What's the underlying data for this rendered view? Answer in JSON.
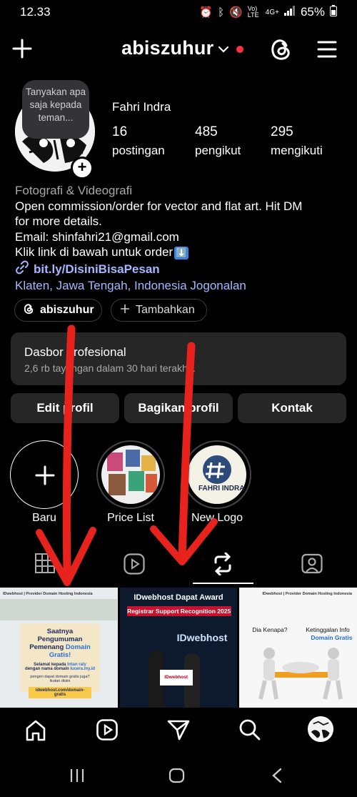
{
  "status": {
    "time": "12.33",
    "battery": "65%",
    "network": "4G+",
    "volte": "Vo) LTE"
  },
  "header": {
    "username": "abiszuhur"
  },
  "note": {
    "text": "Tanyakan apa saja kepada teman..."
  },
  "profile": {
    "name": "Fahri Indra",
    "stats": [
      {
        "value": "16",
        "label": "postingan"
      },
      {
        "value": "485",
        "label": "pengikut"
      },
      {
        "value": "295",
        "label": "mengikuti"
      }
    ]
  },
  "bio": {
    "category": "Fotografi & Videografi",
    "line1": "Open commission/order for vector and flat art. Hit DM",
    "line2": "for more details.",
    "email": "Email: shinfahri21@gmail.com",
    "cta": "Klik link di bawah untuk order",
    "cta_emoji": "⬇️",
    "link": "bit.ly/DisiniBisaPesan",
    "location": "Klaten, Jawa Tengah, Indonesia Jogonalan"
  },
  "pills": {
    "threads": "abiszuhur",
    "add": "Tambahkan"
  },
  "dashboard": {
    "title": "Dasbor profesional",
    "subtitle": "2,6 rb tayangan dalam 30 hari terakhir."
  },
  "buttons": {
    "edit": "Edit profil",
    "share": "Bagikan profil",
    "contact": "Kontak"
  },
  "highlights": [
    {
      "label": "Baru"
    },
    {
      "label": "Price List"
    },
    {
      "label": "New Logo",
      "logo_text": "FAHRI INDRA"
    }
  ],
  "posts": [
    {
      "brand": "IDwebhost | Provider Domain Hosting Indonesia",
      "title1": "Saatnya Pengumuman",
      "title2": "Pemenang",
      "title2_accent": "Domain Gratis!",
      "line1": "Selamat kepada",
      "line1_accent": "lntan raly",
      "line2": "dengan nama domain",
      "line2_accent": "lucera.my.id",
      "line3": "pengen dapat domain gratis juga?",
      "line4": "ikutan disini",
      "url": "idwebhost.com/domain-gratis"
    },
    {
      "title": "IDwebhost Dapat Award",
      "banner": "Registrar Support Recognition 2025",
      "backdrop": "IDwebhost",
      "board": "IDwebhost"
    },
    {
      "brand": "IDwebhost | Provider Domain Hosting Indonesia",
      "q": "Dia Kenapa?",
      "t1": "Ketinggalan Info",
      "t2": "Domain Gratis"
    }
  ],
  "colors": {
    "accent_link": "#a4b9ff",
    "surface": "#262626",
    "arrow": "#e8231e",
    "notif": "#ff3040"
  },
  "icons": [
    "plus-icon",
    "chevron-down-icon",
    "threads-icon",
    "menu-icon",
    "home-icon",
    "reels-icon",
    "send-icon",
    "search-icon",
    "grid-icon",
    "repost-icon",
    "tagged-icon"
  ]
}
